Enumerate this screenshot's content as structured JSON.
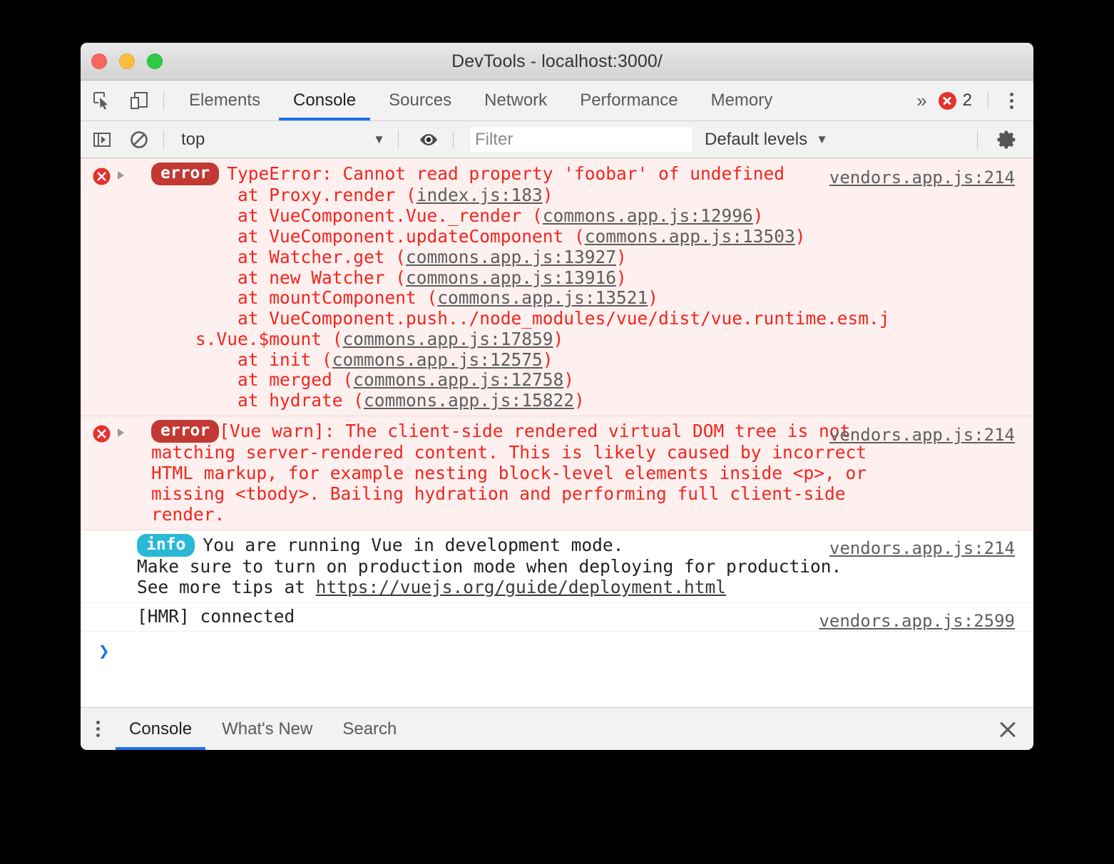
{
  "window": {
    "title": "DevTools - localhost:3000/",
    "traffic_lights": [
      "close",
      "minimize",
      "maximize"
    ]
  },
  "colors": {
    "accent": "#1a73e8",
    "error_red": "#f3251e",
    "error_badge": "#c23934",
    "info_badge": "#29b8d6",
    "error_row_bg": "#fdf0ef",
    "toolbar_bg": "#f2f2f2"
  },
  "toolbar": {
    "inspect_icon": "inspect-element-icon",
    "device_icon": "device-toolbar-icon",
    "tabs": [
      {
        "label": "Elements",
        "active": false
      },
      {
        "label": "Console",
        "active": true
      },
      {
        "label": "Sources",
        "active": false
      },
      {
        "label": "Network",
        "active": false
      },
      {
        "label": "Performance",
        "active": false
      },
      {
        "label": "Memory",
        "active": false
      }
    ],
    "more_tabs_icon": "»",
    "error_count": "2",
    "error_icon": "circle-x-icon",
    "main_menu_icon": "kebab-menu-icon"
  },
  "filterbar": {
    "sidebar_toggle_icon": "console-sidebar-icon",
    "clear_console_icon": "clear-console-icon",
    "context": "top",
    "context_caret": "▼",
    "eye_icon": "live-expression-eye-icon",
    "filter_placeholder": "Filter",
    "filter_value": "",
    "levels_label": "Default levels",
    "levels_caret": "▼",
    "settings_icon": "gear-icon"
  },
  "console": {
    "messages": [
      {
        "kind": "error",
        "badge": "error",
        "title": "TypeError: Cannot read property 'foobar' of undefined",
        "source": "vendors.app.js:214",
        "stack": [
          {
            "text": "    at Proxy.render (",
            "link": "index.js:183",
            "tail": ")"
          },
          {
            "text": "    at VueComponent.Vue._render (",
            "link": "commons.app.js:12996",
            "tail": ")"
          },
          {
            "text": "    at VueComponent.updateComponent (",
            "link": "commons.app.js:13503",
            "tail": ")"
          },
          {
            "text": "    at Watcher.get (",
            "link": "commons.app.js:13927",
            "tail": ")"
          },
          {
            "text": "    at new Watcher (",
            "link": "commons.app.js:13916",
            "tail": ")"
          },
          {
            "text": "    at mountComponent (",
            "link": "commons.app.js:13521",
            "tail": ")"
          },
          {
            "text": "    at VueComponent.push../node_modules/vue/dist/vue.runtime.esm.js.Vue.$mount (",
            "link": "commons.app.js:17859",
            "tail": ")"
          },
          {
            "text": "    at init (",
            "link": "commons.app.js:12575",
            "tail": ")"
          },
          {
            "text": "    at merged (",
            "link": "commons.app.js:12758",
            "tail": ")"
          },
          {
            "text": "    at hydrate (",
            "link": "commons.app.js:15822",
            "tail": ")"
          }
        ]
      },
      {
        "kind": "error",
        "badge": "error",
        "title": "[Vue warn]: The client-side rendered virtual DOM tree is not matching server-rendered content. This is likely caused by incorrect HTML markup, for example nesting block-level elements inside <p>, or missing <tbody>. Bailing hydration and performing full client-side render.",
        "source": "vendors.app.js:214",
        "stack": []
      },
      {
        "kind": "info",
        "badge": "info",
        "line1": "You are running Vue in development mode.",
        "line2": "Make sure to turn on production mode when deploying for production.",
        "line3_prefix": "See more tips at ",
        "line3_link": "https://vuejs.org/guide/deployment.html",
        "source": "vendors.app.js:214"
      },
      {
        "kind": "log",
        "text": "[HMR] connected",
        "source": "vendors.app.js:2599"
      }
    ],
    "prompt_glyph": "❯"
  },
  "drawer": {
    "menu_icon": "kebab-menu-icon",
    "tabs": [
      {
        "label": "Console",
        "active": true
      },
      {
        "label": "What's New",
        "active": false
      },
      {
        "label": "Search",
        "active": false
      }
    ],
    "close_icon": "close-icon"
  }
}
